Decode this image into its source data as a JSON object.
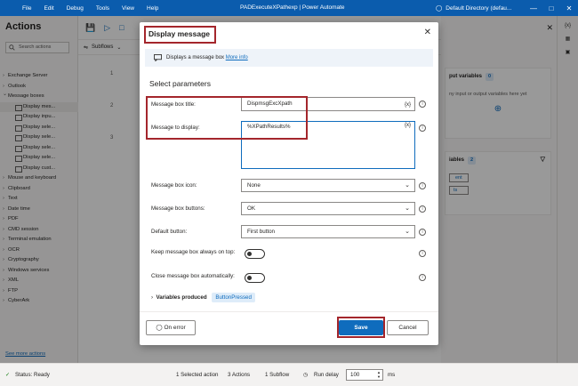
{
  "titlebar": {
    "menu": [
      "File",
      "Edit",
      "Debug",
      "Tools",
      "View",
      "Help"
    ],
    "app_title": "PADExecuteXPathexp | Power Automate",
    "user": "Default Directory (defau..."
  },
  "actions_panel": {
    "title": "Actions",
    "search_placeholder": "Search actions",
    "items": [
      {
        "label": "Exchange Server",
        "type": "category"
      },
      {
        "label": "Outlook",
        "type": "category"
      },
      {
        "label": "Message boxes",
        "type": "category-open"
      },
      {
        "label": "Display mes...",
        "type": "sub",
        "selected": true
      },
      {
        "label": "Display inpu...",
        "type": "sub"
      },
      {
        "label": "Display sele...",
        "type": "sub"
      },
      {
        "label": "Display sele...",
        "type": "sub"
      },
      {
        "label": "Display sele...",
        "type": "sub"
      },
      {
        "label": "Display sele...",
        "type": "sub"
      },
      {
        "label": "Display cust...",
        "type": "sub"
      },
      {
        "label": "Mouse and keyboard",
        "type": "category"
      },
      {
        "label": "Clipboard",
        "type": "category"
      },
      {
        "label": "Text",
        "type": "category"
      },
      {
        "label": "Date time",
        "type": "category"
      },
      {
        "label": "PDF",
        "type": "category"
      },
      {
        "label": "CMD session",
        "type": "category"
      },
      {
        "label": "Terminal emulation",
        "type": "category"
      },
      {
        "label": "OCR",
        "type": "category"
      },
      {
        "label": "Cryptography",
        "type": "category"
      },
      {
        "label": "Windows services",
        "type": "category"
      },
      {
        "label": "XML",
        "type": "category"
      },
      {
        "label": "FTP",
        "type": "category"
      },
      {
        "label": "CyberArk",
        "type": "category"
      }
    ],
    "more_link": "See more actions"
  },
  "center": {
    "subflows_label": "Subflows",
    "line_numbers": [
      "1",
      "2",
      "3"
    ]
  },
  "variables_panel": {
    "io_header": "put variables",
    "io_count": "0",
    "io_empty": "ny input or output variables here yet",
    "flow_header": "iables",
    "flow_count": "2",
    "chip1": "ent",
    "chip2": "ts"
  },
  "dialog": {
    "title": "Display message",
    "description": "Displays a message box",
    "more_info": "More info",
    "section": "Select parameters",
    "fields": {
      "title_label": "Message box title:",
      "title_value": "DispmsgExcXpath",
      "message_label": "Message to display:",
      "message_value": "%XPathResults%",
      "icon_label": "Message box icon:",
      "icon_value": "None",
      "buttons_label": "Message box buttons:",
      "buttons_value": "OK",
      "default_label": "Default button:",
      "default_value": "First button",
      "ontop_label": "Keep message box always on top:",
      "autoclose_label": "Close message box automatically:"
    },
    "variables_produced": "Variables produced",
    "variable_pill": "ButtonPressed",
    "on_error": "On error",
    "save": "Save",
    "cancel": "Cancel",
    "var_button": "{x}"
  },
  "statusbar": {
    "status": "Status: Ready",
    "selected": "1 Selected action",
    "actions": "3 Actions",
    "subflows": "1 Subflow",
    "run_delay_label": "Run delay",
    "run_delay_value": "100",
    "unit": "ms"
  },
  "colors": {
    "accent": "#0f6cbd",
    "titlebar": "#0b5cad",
    "highlight": "#a4262c"
  }
}
